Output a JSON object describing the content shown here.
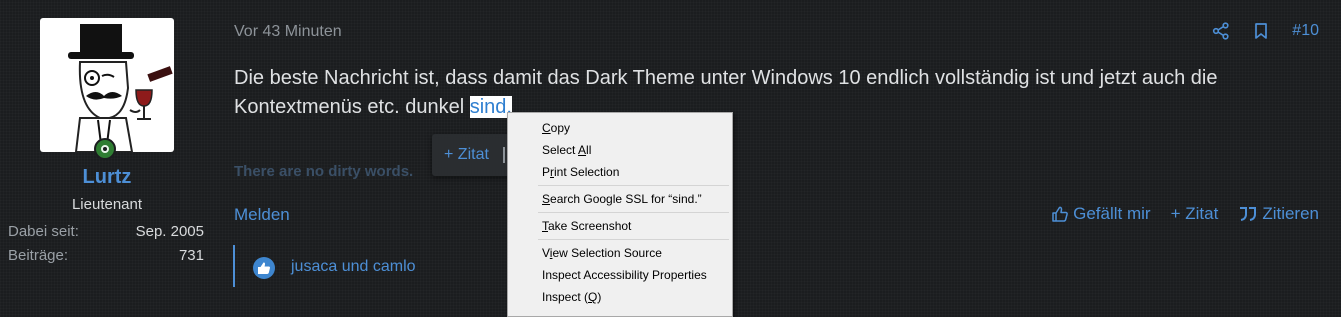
{
  "user": {
    "name": "Lurtz",
    "title": "Lieutenant",
    "stats": [
      {
        "label": "Dabei seit:",
        "value": "Sep. 2005"
      },
      {
        "label": "Beiträge:",
        "value": "731"
      }
    ]
  },
  "post": {
    "date": "Vor 43 Minuten",
    "number": "#10",
    "body_before": "Die beste Nachricht ist, dass damit das Dark Theme unter Windows 10 endlich vollständig ist und jetzt auch die Kontextmenüs etc. dunkel ",
    "body_selected": "sind.",
    "quote_popup_label": "+ Zitat",
    "signature": "There are no dirty words.",
    "report_label": "Melden",
    "like_label": "Gefällt mir",
    "quote_label": "+ Zitat",
    "cite_label": "Zitieren",
    "likes_text": "jusaca und camlo"
  },
  "context_menu": {
    "items": [
      {
        "pre": "",
        "key": "C",
        "post": "opy"
      },
      {
        "pre": "Select ",
        "key": "A",
        "post": "ll"
      },
      {
        "pre": "P",
        "key": "r",
        "post": "int Selection"
      },
      {
        "pre": "",
        "key": "S",
        "post": "earch Google SSL for “sind.”"
      },
      {
        "pre": "",
        "key": "T",
        "post": "ake Screenshot"
      },
      {
        "pre": "V",
        "key": "i",
        "post": "ew Selection Source"
      },
      {
        "pre": "Inspect Accessibility Properties",
        "key": "",
        "post": ""
      },
      {
        "pre": "Inspect (",
        "key": "Q",
        "post": ")"
      }
    ]
  },
  "colors": {
    "background": "#1b1d1f",
    "accent": "#4d8fd6",
    "online": "#2f7d32"
  }
}
